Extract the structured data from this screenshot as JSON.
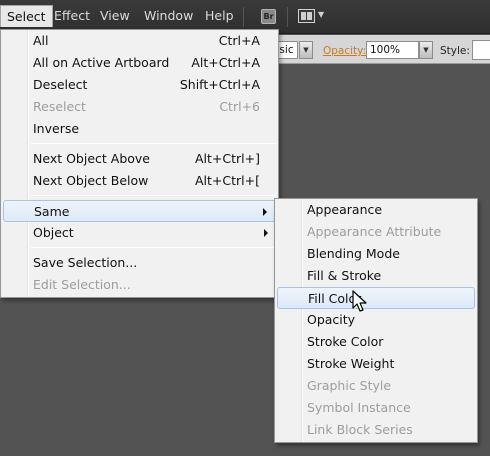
{
  "menubar": {
    "items": [
      {
        "label": "Select",
        "active": true
      },
      {
        "label": "Effect"
      },
      {
        "label": "View"
      },
      {
        "label": "Window"
      },
      {
        "label": "Help"
      }
    ],
    "bridge_icon_text": "Br"
  },
  "controlbar": {
    "brush_value": "asic",
    "opacity_label": "Opacity:",
    "opacity_value": "100%",
    "style_label": "Style:"
  },
  "select_menu": {
    "items": [
      {
        "label": "All",
        "shortcut": "Ctrl+A"
      },
      {
        "label": "All on Active Artboard",
        "shortcut": "Alt+Ctrl+A"
      },
      {
        "label": "Deselect",
        "shortcut": "Shift+Ctrl+A"
      },
      {
        "label": "Reselect",
        "shortcut": "Ctrl+6",
        "disabled": true
      },
      {
        "label": "Inverse"
      },
      {
        "label": "Next Object Above",
        "shortcut": "Alt+Ctrl+]"
      },
      {
        "label": "Next Object Below",
        "shortcut": "Alt+Ctrl+["
      },
      {
        "label": "Same",
        "submenu": true,
        "highlighted": true
      },
      {
        "label": "Object",
        "submenu": true
      },
      {
        "label": "Save Selection..."
      },
      {
        "label": "Edit Selection...",
        "disabled": true
      }
    ]
  },
  "same_submenu": {
    "items": [
      {
        "label": "Appearance"
      },
      {
        "label": "Appearance Attribute",
        "disabled": true
      },
      {
        "label": "Blending Mode"
      },
      {
        "label": "Fill & Stroke"
      },
      {
        "label": "Fill Color",
        "highlighted": true
      },
      {
        "label": "Opacity"
      },
      {
        "label": "Stroke Color"
      },
      {
        "label": "Stroke Weight"
      },
      {
        "label": "Graphic Style",
        "disabled": true
      },
      {
        "label": "Symbol Instance",
        "disabled": true
      },
      {
        "label": "Link Block Series",
        "disabled": true
      }
    ]
  },
  "colors": {
    "canvas": "#535353",
    "menubar": "#2f2f2f",
    "menu_bg": "#f1f1f1",
    "highlight_border": "#a8c4e4",
    "opacity_link": "#c77b22",
    "disabled_text": "#9d9d9d"
  },
  "icons": [
    "bridge-icon",
    "workspace-layout-icon",
    "submenu-arrow-icon",
    "mouse-pointer-icon"
  ]
}
